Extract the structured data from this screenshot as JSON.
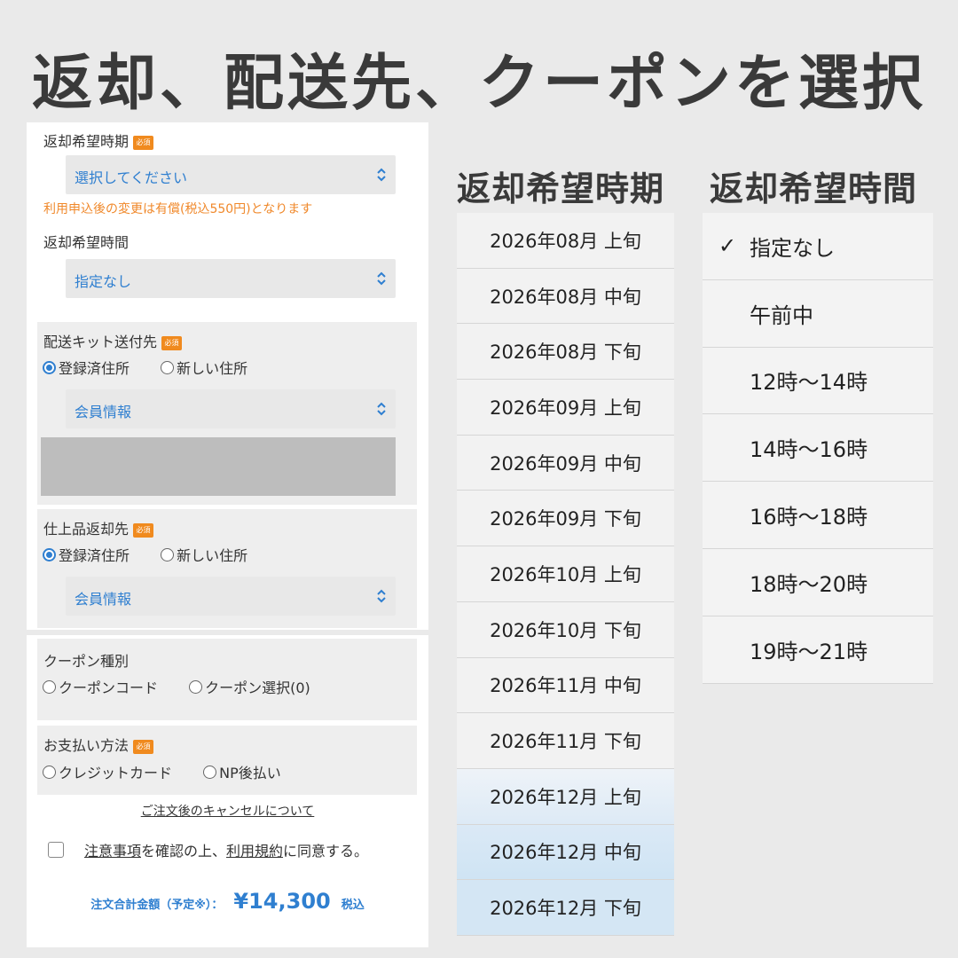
{
  "page_title": "返却、配送先、クーポンを選択",
  "form": {
    "return_date": {
      "label": "返却希望時期",
      "badge": "必須",
      "select_value": "選択してください",
      "note": "利用申込後の変更は有償(税込550円)となります"
    },
    "return_time": {
      "label": "返却希望時間",
      "select_value": "指定なし"
    },
    "kit_address": {
      "label": "配送キット送付先",
      "badge": "必須",
      "options": [
        "登録済住所",
        "新しい住所"
      ],
      "selected": "登録済住所",
      "select_value": "会員情報"
    },
    "return_address": {
      "label": "仕上品返却先",
      "badge": "必須",
      "options": [
        "登録済住所",
        "新しい住所"
      ],
      "selected": "登録済住所",
      "select_value": "会員情報"
    },
    "coupon": {
      "label": "クーポン種別",
      "options": [
        "クーポンコード",
        "クーポン選択(0)"
      ]
    },
    "payment": {
      "label": "お支払い方法",
      "badge": "必須",
      "options": [
        "クレジットカード",
        "NP後払い"
      ]
    },
    "cancel_link": "ご注文後のキャンセルについて",
    "agree": {
      "part1": "注意事項",
      "part2": "を確認の上、",
      "part3": "利用規約",
      "part4": "に同意する。"
    },
    "total": {
      "label": "注文合計金額（予定※）：",
      "amount": "¥14,300",
      "tax": "税込"
    }
  },
  "date_picker": {
    "title": "返却希望時期",
    "items": [
      "2026年08月 上旬",
      "2026年08月 中旬",
      "2026年08月 下旬",
      "2026年09月 上旬",
      "2026年09月 中旬",
      "2026年09月 下旬",
      "2026年10月 上旬",
      "2026年10月 下旬",
      "2026年11月 中旬",
      "2026年11月 下旬",
      "2026年12月 上旬",
      "2026年12月 中旬",
      "2026年12月 下旬"
    ]
  },
  "time_picker": {
    "title": "返却希望時間",
    "items": [
      "指定なし",
      "午前中",
      "12時～14時",
      "14時～16時",
      "16時～18時",
      "18時～20時",
      "19時～21時"
    ],
    "selected_index": 0,
    "check_mark": "✓"
  },
  "colors": {
    "accent": "#2f7fd0",
    "badge": "#f08a1e",
    "note": "#f0882a"
  }
}
